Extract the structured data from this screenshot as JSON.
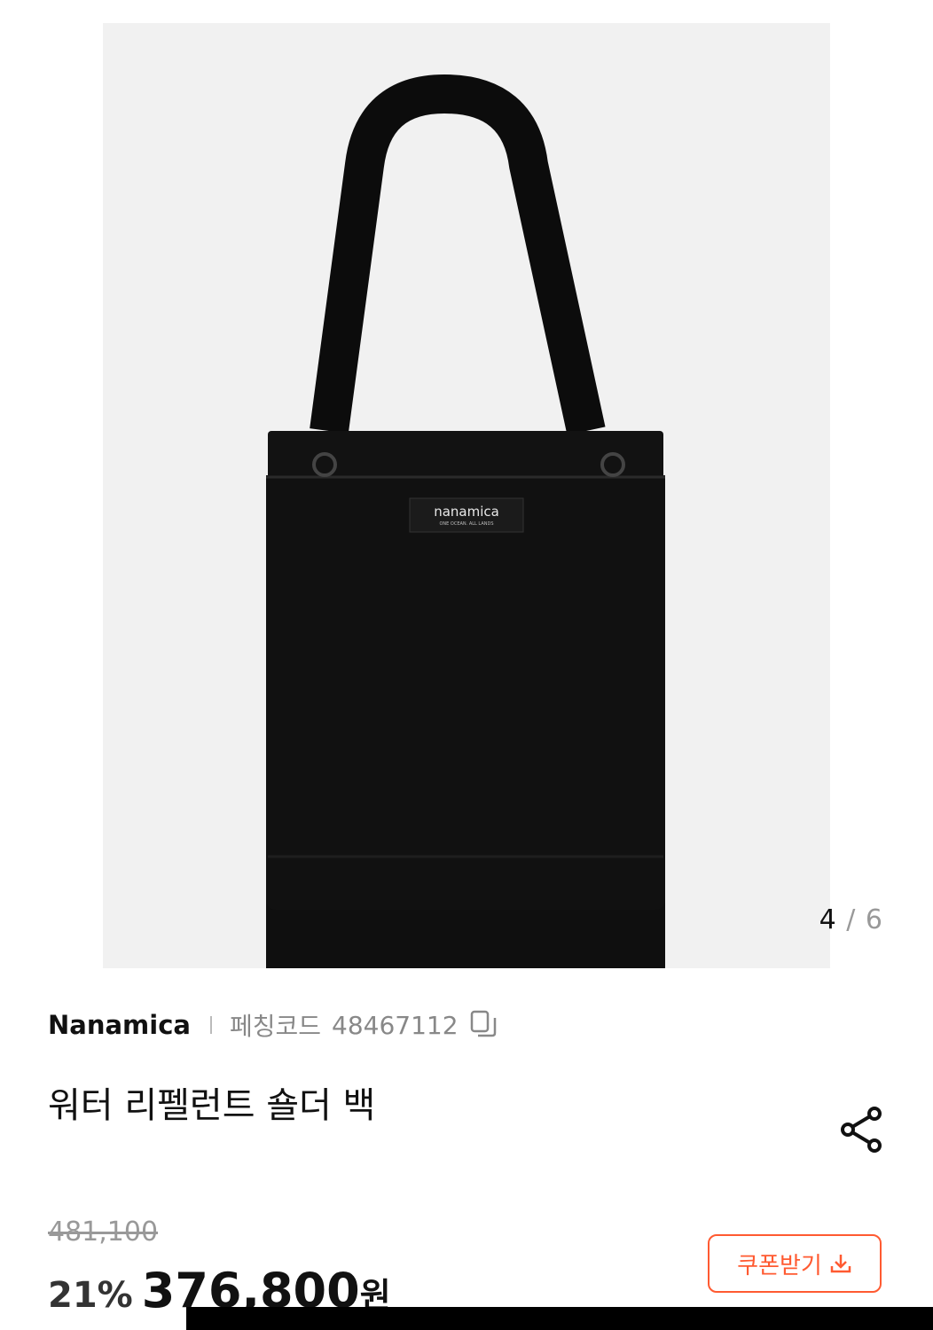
{
  "gallery": {
    "current_index": "4",
    "separator": "/",
    "total": "6",
    "label_text": "nanamica",
    "label_subtext": "ONE OCEAN. ALL LANDS"
  },
  "product": {
    "brand": "Nanamica",
    "code_label": "페칭코드",
    "code_value": "48467112",
    "title": "워터 리펠런트 숄더 백"
  },
  "pricing": {
    "original_price": "481,100",
    "discount": "21%",
    "price": "376,800",
    "currency": "원"
  },
  "actions": {
    "coupon_label": "쿠폰받기"
  },
  "colors": {
    "accent": "#ff5a31",
    "background_gallery": "#f1f1f1"
  },
  "icons": {
    "copy": "copy-icon",
    "share": "share-icon",
    "download": "download-icon"
  }
}
